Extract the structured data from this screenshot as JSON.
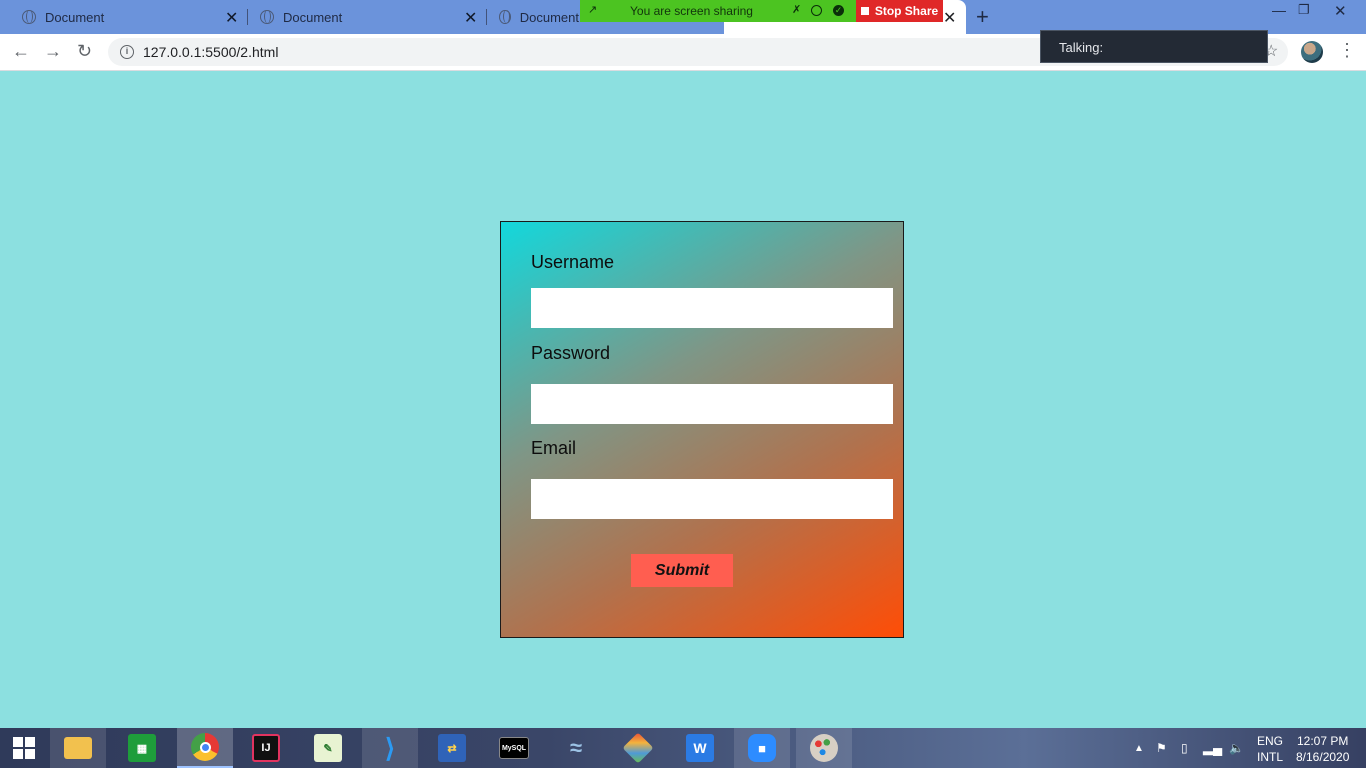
{
  "browser": {
    "tabs": [
      {
        "title": "Document"
      },
      {
        "title": "Document"
      },
      {
        "title": "Document"
      }
    ],
    "url": "127.0.0.1:5500/2.html"
  },
  "zoom": {
    "sharing_text": "You are screen sharing",
    "stop_share_label": "Stop Share",
    "talking_label": "Talking:"
  },
  "form": {
    "username_label": "Username",
    "password_label": "Password",
    "email_label": "Email",
    "username_value": "",
    "password_value": "",
    "email_value": "",
    "submit_label": "Submit"
  },
  "taskbar": {
    "apps": [
      {
        "name": "File Explorer"
      },
      {
        "name": "Microsoft Store"
      },
      {
        "name": "Google Chrome"
      },
      {
        "name": "IntelliJ IDEA"
      },
      {
        "name": "Notepad++"
      },
      {
        "name": "Visual Studio Code"
      },
      {
        "name": "FileZilla"
      },
      {
        "name": "MySQL Shell"
      },
      {
        "name": "MySQL Workbench"
      },
      {
        "name": "Git"
      },
      {
        "name": "WPS Office"
      },
      {
        "name": "Zoom"
      },
      {
        "name": "Paint"
      }
    ],
    "language": "ENG",
    "layout": "INTL",
    "time": "12:07 PM",
    "date": "8/16/2020"
  },
  "colors": {
    "page_background": "#8ce0e0",
    "tabstrip": "#6b93db",
    "share_bar": "#4cc421",
    "stop_share": "#e02828",
    "submit_button": "#ff5e50",
    "card_gradient_start": "#12d8dc",
    "card_gradient_end": "#ff4d06"
  }
}
